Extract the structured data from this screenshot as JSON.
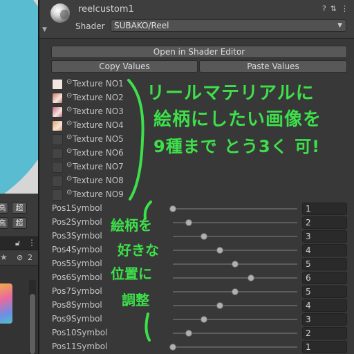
{
  "left_panel": {
    "button_labels": [
      "高",
      "超",
      "高",
      "超"
    ],
    "toolbar_badge": "2"
  },
  "header": {
    "material_name": "reelcustom1",
    "help_icon": "?",
    "settings_icon": "⇅",
    "menu_icon": "⋮",
    "shader_label": "Shader",
    "shader_value": "SUBAKO/Reel"
  },
  "buttons": {
    "open_shader_editor": "Open in Shader Editor",
    "copy_values": "Copy Values",
    "paste_values": "Paste Values"
  },
  "textures": [
    {
      "label": "Texture NO1",
      "swatch": "#e8e8e8"
    },
    {
      "label": "Texture NO2",
      "swatch": "#c87a6a"
    },
    {
      "label": "Texture NO3",
      "swatch": "#c96a86"
    },
    {
      "label": "Texture NO4",
      "swatch": "#e2a06a"
    },
    {
      "label": "Texture NO5",
      "swatch": null
    },
    {
      "label": "Texture NO6",
      "swatch": null
    },
    {
      "label": "Texture NO7",
      "swatch": null
    },
    {
      "label": "Texture NO8",
      "swatch": null
    },
    {
      "label": "Texture NO9",
      "swatch": null
    }
  ],
  "positions": [
    {
      "label": "Pos1Symbol",
      "value": "1",
      "fraction": 0.0
    },
    {
      "label": "Pos2Symbol",
      "value": "2",
      "fraction": 0.125
    },
    {
      "label": "Pos3Symbol",
      "value": "3",
      "fraction": 0.25
    },
    {
      "label": "Pos4Symbol",
      "value": "4",
      "fraction": 0.375
    },
    {
      "label": "Pos5Symbol",
      "value": "5",
      "fraction": 0.5
    },
    {
      "label": "Pos6Symbol",
      "value": "6",
      "fraction": 0.625
    },
    {
      "label": "Pos7Symbol",
      "value": "5",
      "fraction": 0.5
    },
    {
      "label": "Pos8Symbol",
      "value": "4",
      "fraction": 0.375
    },
    {
      "label": "Pos9Symbol",
      "value": "3",
      "fraction": 0.25
    },
    {
      "label": "Pos10Symbol",
      "value": "2",
      "fraction": 0.125
    },
    {
      "label": "Pos11Symbol",
      "value": "1",
      "fraction": 0.0
    }
  ],
  "annotations": {
    "line1": "リールマテリアルに",
    "line2": "絵柄にしたい画像を",
    "line3": "9種まで とう3く 可!",
    "side1": "絵柄を",
    "side2": "好きな",
    "side3": "位置に",
    "side4": "調整"
  },
  "colors": {
    "annotation_green": "#3de04a"
  }
}
